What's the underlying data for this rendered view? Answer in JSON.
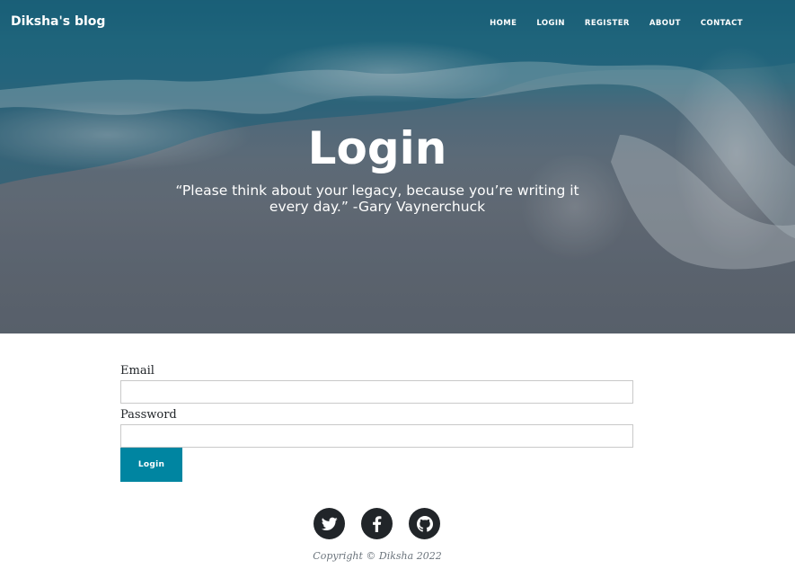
{
  "header": {
    "brand": "Diksha's blog",
    "nav": [
      "HOME",
      "LOGIN",
      "REGISTER",
      "ABOUT",
      "CONTACT"
    ]
  },
  "hero": {
    "title": "Login",
    "subtitle": "“Please think about your legacy, because you’re writing it every day.” -Gary Vaynerchuck"
  },
  "form": {
    "email_label": "Email",
    "email_value": "",
    "password_label": "Password",
    "password_value": "",
    "submit_label": "Login"
  },
  "footer": {
    "social": [
      "twitter-icon",
      "facebook-icon",
      "github-icon"
    ],
    "copyright": "Copyright © Diksha 2022"
  },
  "colors": {
    "button": "#0085a1",
    "social_circle": "#212529",
    "copyright_text": "#6c757d"
  }
}
